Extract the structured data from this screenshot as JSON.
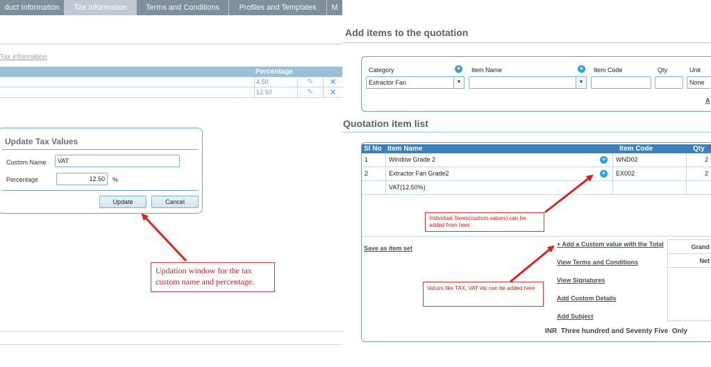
{
  "tabs": [
    {
      "label": "duct Information",
      "active": false
    },
    {
      "label": "Tax Information",
      "active": true
    },
    {
      "label": "Terms and Conditions",
      "active": false
    },
    {
      "label": "Profiles and Templates",
      "active": false
    },
    {
      "label": "M",
      "active": false
    }
  ],
  "tax_section": {
    "link_label": "Tax information",
    "column_header": "Percentage",
    "rows": [
      {
        "percentage": "4.50"
      },
      {
        "percentage": "12.50"
      }
    ]
  },
  "dialog": {
    "title": "Update Tax Values",
    "custom_name_label": "Custom Name",
    "custom_name_value": "VAT",
    "percentage_label": "Percentage",
    "percentage_value": "12.50",
    "unit": "%",
    "update_label": "Update",
    "cancel_label": "Cancel"
  },
  "annotations": {
    "left_callout": "Updation window for the tax custom name and percentage.",
    "taxes_callout": "Individual Taxes(custom values) can be added from here",
    "values_callout": "Values like TAX, VAT etc can be added here"
  },
  "add_items": {
    "title": "Add items to the quotation",
    "category_label": "Category",
    "category_value": "Extractor Fan",
    "item_name_label": "Item Name",
    "item_name_value": "",
    "item_code_label": "Item Code",
    "qty_label": "Qty",
    "unit_label": "Unit",
    "unit_value": "None",
    "add_link": "A"
  },
  "quotation_list": {
    "title": "Quotation item list",
    "columns": [
      "Sl No",
      "Item Name",
      "Item Code",
      "Qty"
    ],
    "rows": [
      {
        "sl": "1",
        "name": "Window Grade 2",
        "code": "WND02",
        "qty": "2"
      },
      {
        "sl": "2",
        "name": "Extractor Fan Grade2",
        "code": "EX002",
        "qty": "2"
      },
      {
        "sl": "",
        "name": "VAT(12.50%)",
        "code": "",
        "qty": ""
      }
    ],
    "save_link": "Save as item set",
    "links": [
      "+ Add a Custom value with the Total",
      "View Terms and Conditions",
      "View Signatures",
      "Add Custom Details",
      "Add Subject"
    ],
    "totals": [
      "Grand",
      "Net"
    ],
    "amount_words": "INR  Three hundred and Seventy Five  Only"
  },
  "colors": {
    "tab_bar": "#7f8f9c",
    "header_blue": "#3d80b8",
    "accent_blue": "#2e9ee0",
    "callout_red": "#cc1f1f"
  }
}
